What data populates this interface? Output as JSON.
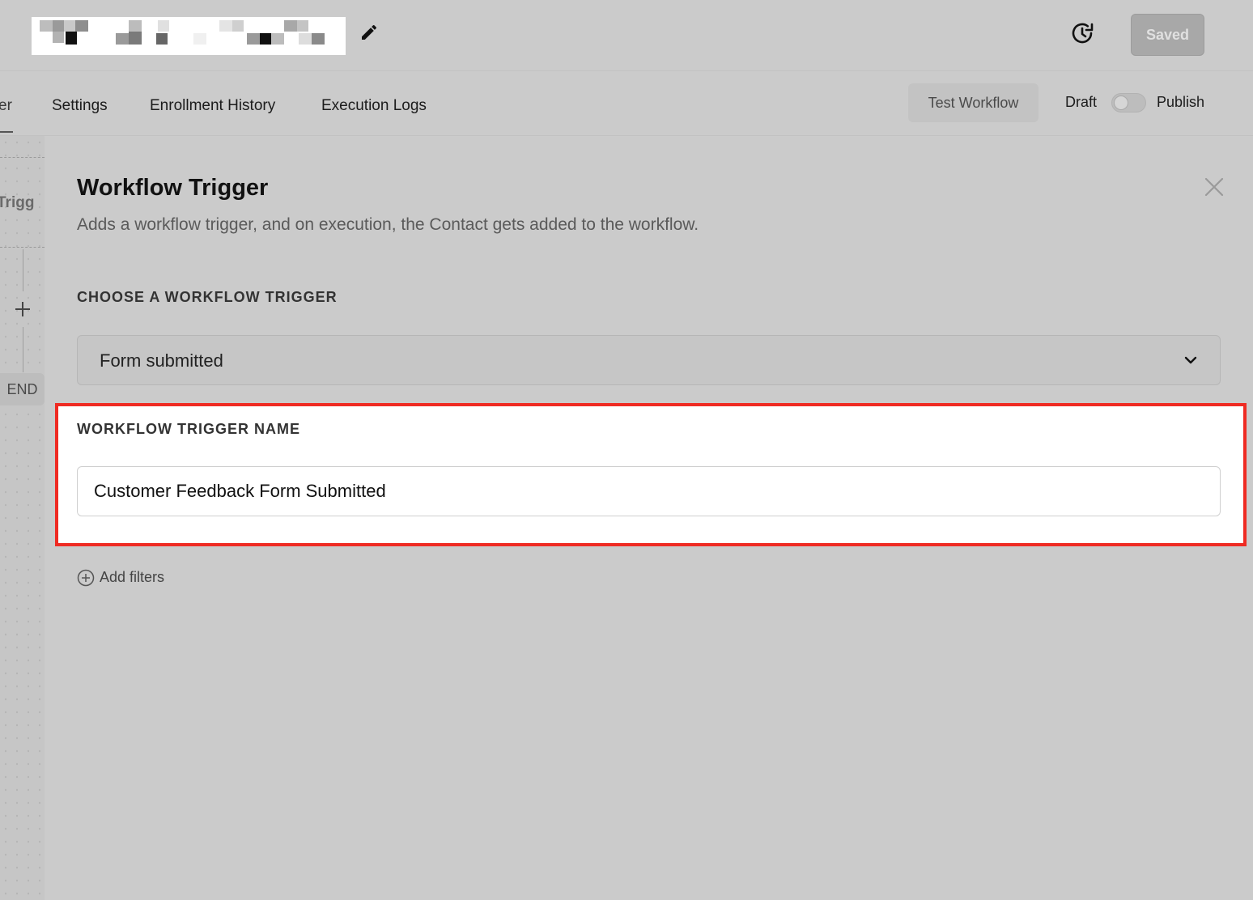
{
  "header": {
    "saved_label": "Saved"
  },
  "nav": {
    "cut_tab_label": "er",
    "tabs": [
      {
        "label": "Settings"
      },
      {
        "label": "Enrollment History"
      },
      {
        "label": "Execution Logs"
      }
    ],
    "test_workflow_label": "Test Workflow",
    "draft_label": "Draft",
    "publish_label": "Publish",
    "publish_toggle_on": false
  },
  "canvas": {
    "node_label": "Trigg",
    "end_label": "END"
  },
  "panel": {
    "title": "Workflow Trigger",
    "description": "Adds a workflow trigger, and on execution, the Contact gets added to the workflow.",
    "choose_label": "CHOOSE A WORKFLOW TRIGGER",
    "selected_trigger": "Form submitted",
    "name_label": "WORKFLOW TRIGGER NAME",
    "name_value": "Customer Feedback Form Submitted",
    "add_filters_label": "Add filters"
  },
  "colors": {
    "highlight": "#ef2b23",
    "overlay": "#cbcbcb"
  }
}
